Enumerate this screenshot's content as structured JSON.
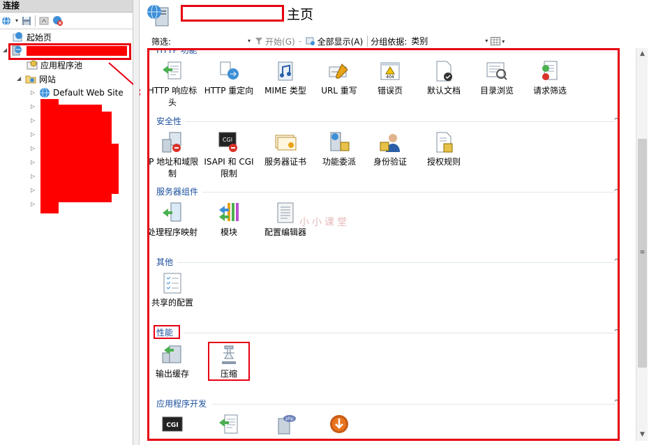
{
  "left": {
    "title": "连接",
    "tree": {
      "start_page": "起始页",
      "app_pools": "应用程序池",
      "sites": "网站",
      "default_site": "Default Web Site"
    }
  },
  "header": {
    "title": "主页"
  },
  "filter_bar": {
    "filter_label": "筛选:",
    "start_label": "开始(G)",
    "show_all_label": "全部显示(A)",
    "group_by_label": "分组依据:",
    "group_by_value": "类别"
  },
  "groups": [
    {
      "title": "HTTP 功能",
      "items": [
        {
          "label": "HTTP 响应标头",
          "icon": "http-response-headers-icon"
        },
        {
          "label": "HTTP 重定向",
          "icon": "http-redirect-icon"
        },
        {
          "label": "MIME 类型",
          "icon": "mime-types-icon"
        },
        {
          "label": "URL 重写",
          "icon": "url-rewrite-icon"
        },
        {
          "label": "错误页",
          "icon": "error-pages-icon"
        },
        {
          "label": "默认文档",
          "icon": "default-document-icon"
        },
        {
          "label": "目录浏览",
          "icon": "directory-browsing-icon"
        },
        {
          "label": "请求筛选",
          "icon": "request-filtering-icon"
        }
      ]
    },
    {
      "title": "安全性",
      "items": [
        {
          "label": "IP 地址和域限制",
          "icon": "ip-restrictions-icon"
        },
        {
          "label": "ISAPI 和 CGI 限制",
          "icon": "isapi-cgi-icon"
        },
        {
          "label": "服务器证书",
          "icon": "server-certificates-icon"
        },
        {
          "label": "功能委派",
          "icon": "feature-delegation-icon"
        },
        {
          "label": "身份验证",
          "icon": "authentication-icon"
        },
        {
          "label": "授权规则",
          "icon": "authorization-rules-icon"
        }
      ]
    },
    {
      "title": "服务器组件",
      "items": [
        {
          "label": "处理程序映射",
          "icon": "handler-mappings-icon"
        },
        {
          "label": "模块",
          "icon": "modules-icon"
        },
        {
          "label": "配置编辑器",
          "icon": "configuration-editor-icon"
        }
      ]
    },
    {
      "title": "其他",
      "items": [
        {
          "label": "共享的配置",
          "icon": "shared-configuration-icon"
        }
      ]
    },
    {
      "title": "性能",
      "items": [
        {
          "label": "输出缓存",
          "icon": "output-caching-icon"
        },
        {
          "label": "压缩",
          "icon": "compression-icon"
        }
      ]
    },
    {
      "title": "应用程序开发",
      "items": [
        {
          "label": "",
          "icon": "cgi-icon"
        },
        {
          "label": "",
          "icon": "fastcgi-icon"
        },
        {
          "label": "",
          "icon": "php-manager-icon"
        },
        {
          "label": "",
          "icon": "web-platform-installer-icon"
        }
      ]
    }
  ],
  "watermark": "小小课堂",
  "colors": {
    "accent_red": "#e60012",
    "group_title": "#1a4f9c"
  }
}
